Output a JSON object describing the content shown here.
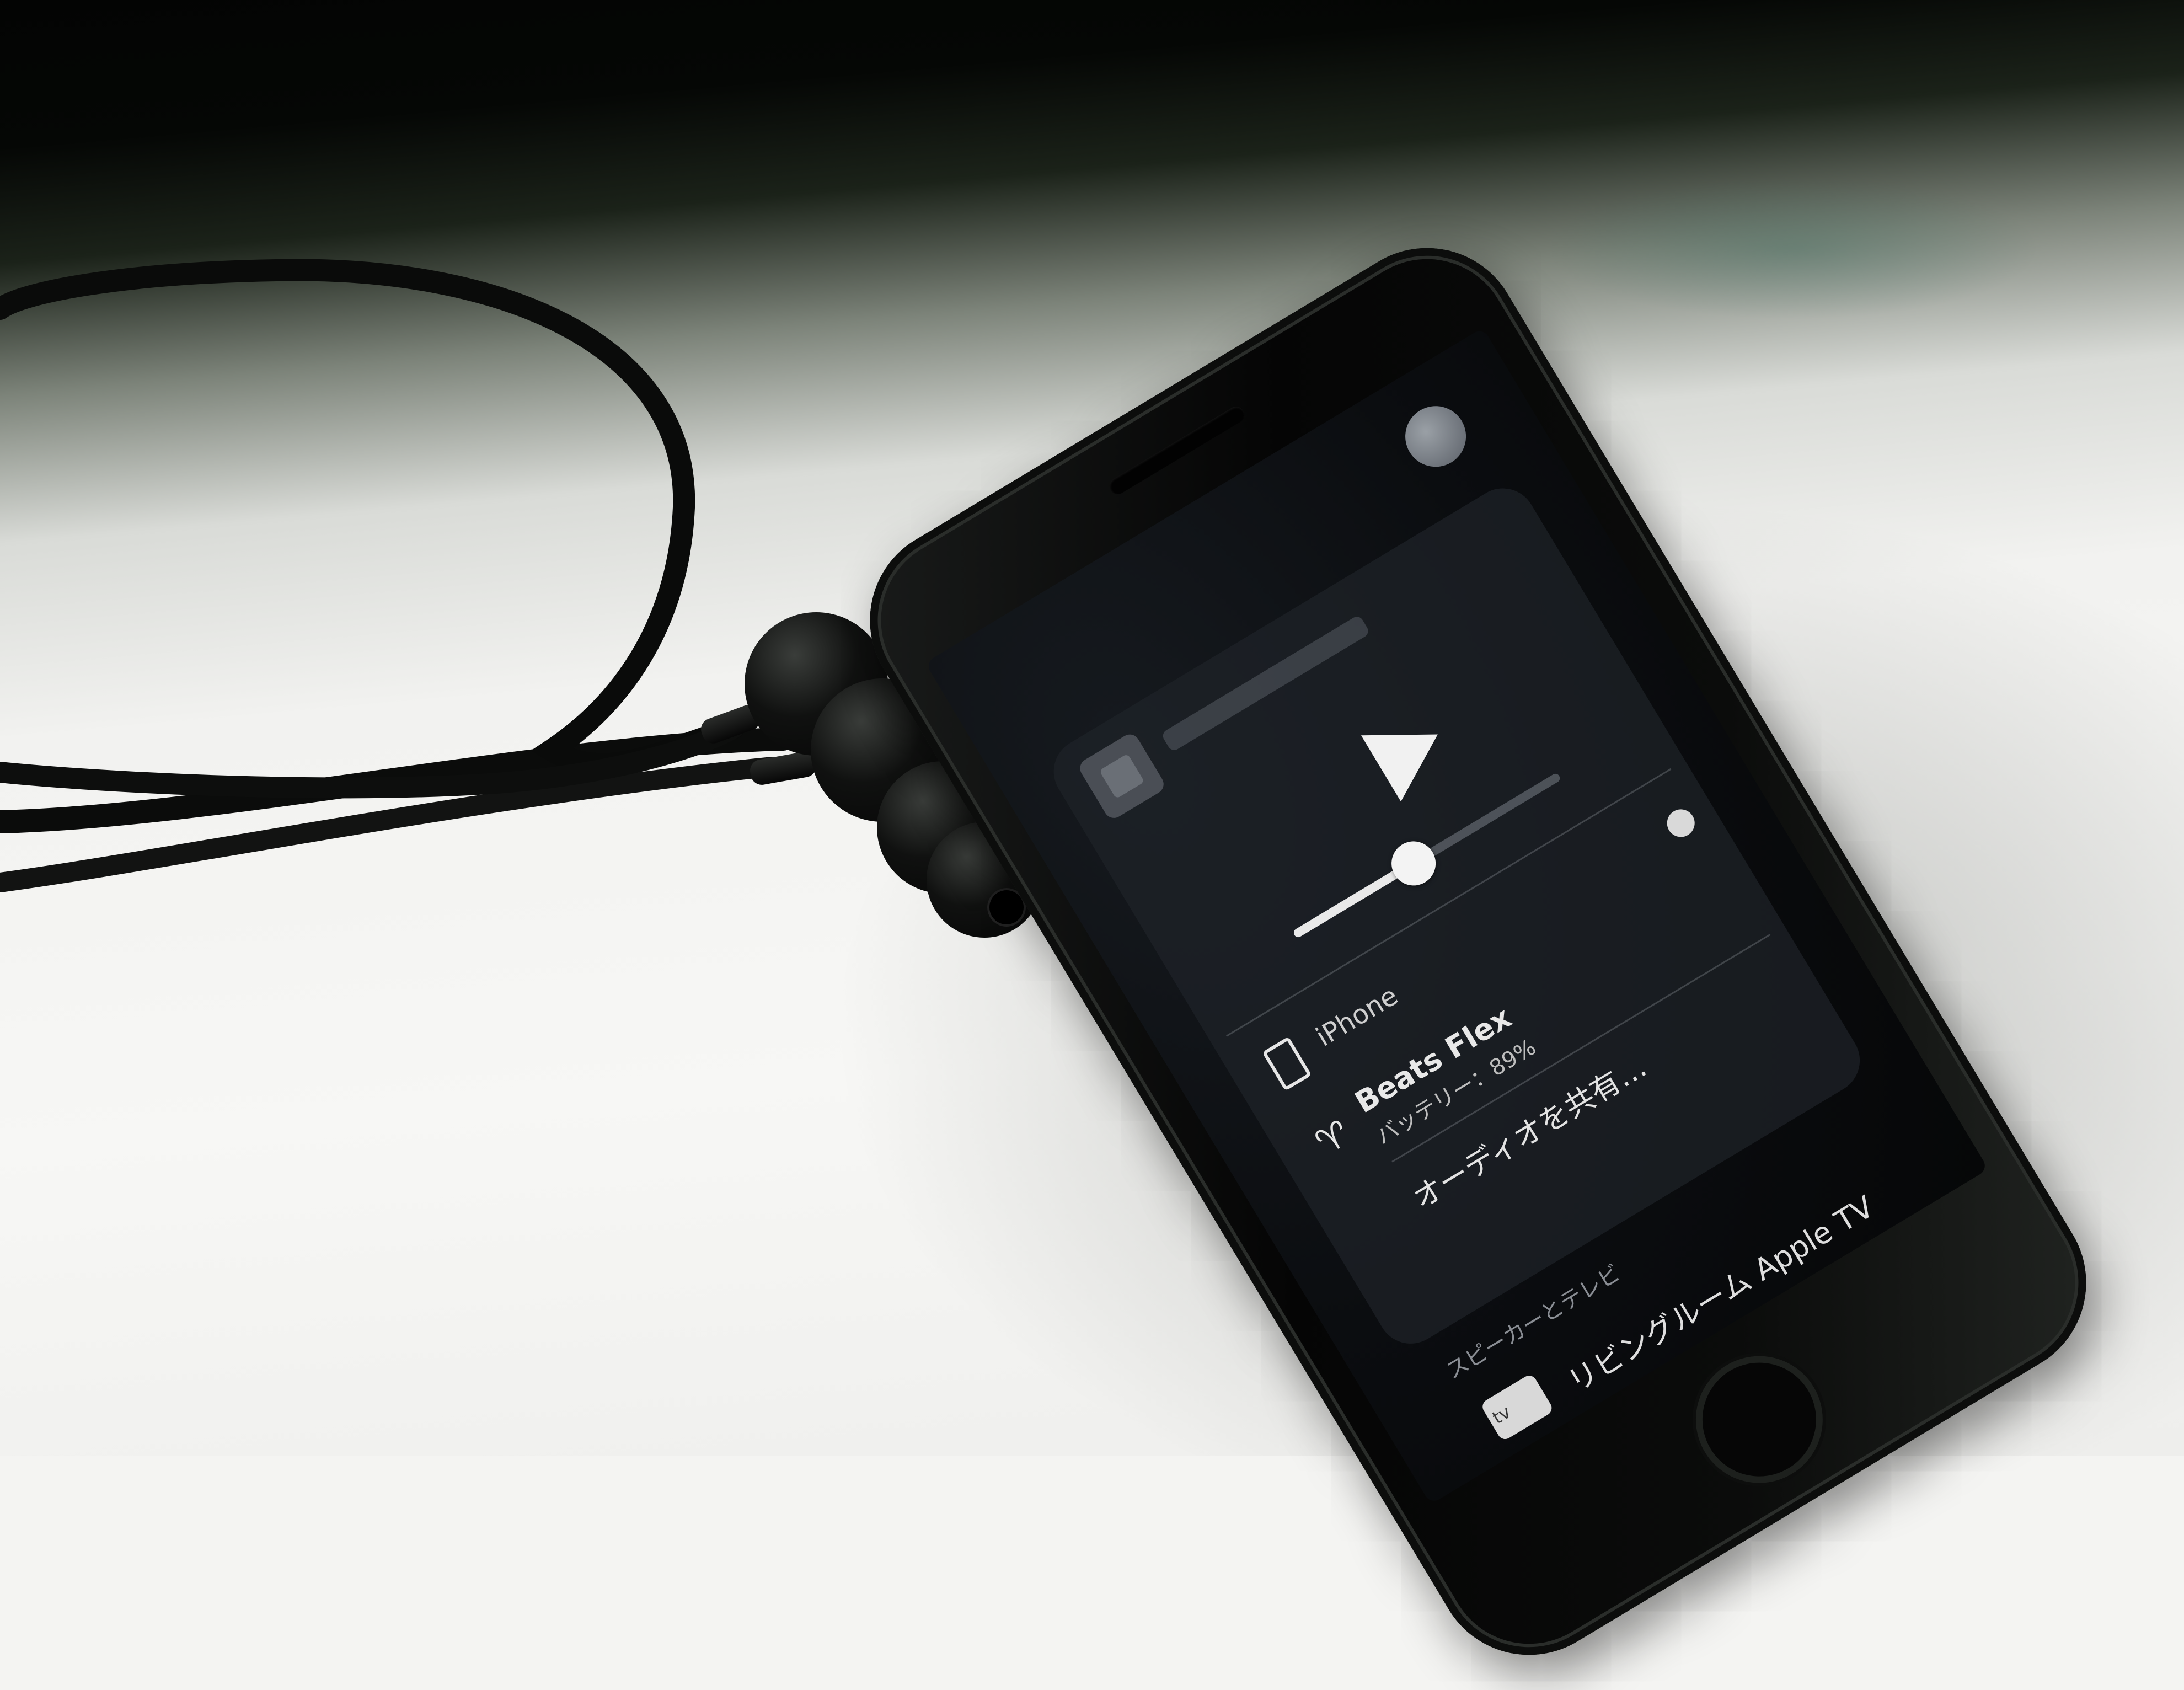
{
  "scene": {
    "surface": "white desk",
    "objects": [
      "wireless earphones",
      "smartphone"
    ]
  },
  "phone_screen": {
    "current_device_label": "iPhone",
    "connected_device": {
      "name": "Beats Flex",
      "battery_label": "バッテリー：89%"
    },
    "share_audio_label": "オーディオを共有…",
    "section_header": "スピーカーとテレビ",
    "speaker_item": {
      "name": "リビングルーム Apple TV",
      "icon_label": "tv"
    },
    "volume_level": 0.45
  },
  "colors": {
    "desk": "#f4f4f2",
    "phone_body": "#0a0a0a",
    "screen": "#0b0d10",
    "accent_text": "#e8e8e8"
  },
  "icons": {
    "device_phone": "phone-icon",
    "device_earphones": "earphones-icon",
    "speaker": "apple-tv-icon",
    "play": "play-icon",
    "airplay": "airplay-icon"
  }
}
